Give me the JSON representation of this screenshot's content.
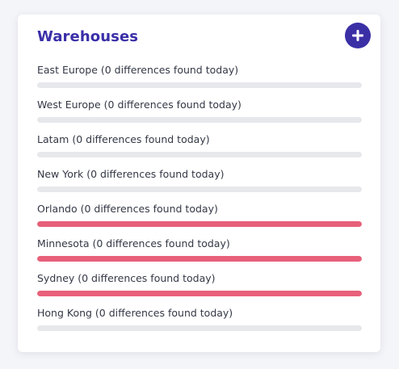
{
  "widget": {
    "title": "Warehouses",
    "add_button_icon": "plus-icon",
    "colors": {
      "title": "#3a2fa8",
      "add_button": "#3b2fa6",
      "alert_bar": "#e8607a",
      "track": "#e6e8ec"
    }
  },
  "warehouses": [
    {
      "label": "East Europe (0 differences found today)",
      "progress": 0
    },
    {
      "label": "West Europe (0 differences found today)",
      "progress": 0
    },
    {
      "label": "Latam (0 differences found today)",
      "progress": 0
    },
    {
      "label": "New York (0 differences found today)",
      "progress": 0
    },
    {
      "label": "Orlando (0 differences found today)",
      "progress": 1
    },
    {
      "label": "Minnesota (0 differences found today)",
      "progress": 1
    },
    {
      "label": "Sydney (0 differences found today)",
      "progress": 1
    },
    {
      "label": "Hong Kong (0 differences found today)",
      "progress": 0
    }
  ]
}
